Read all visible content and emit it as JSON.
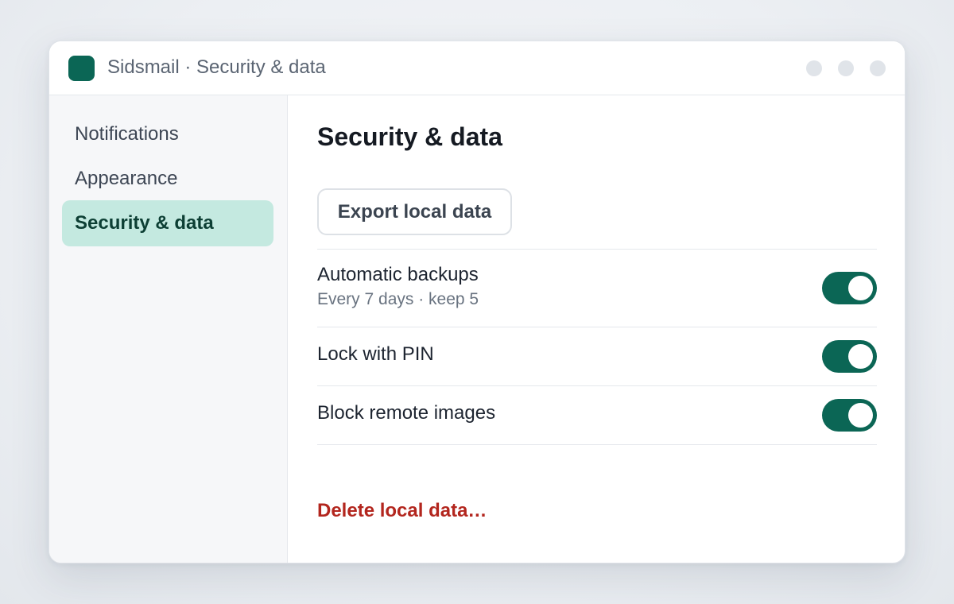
{
  "colors": {
    "accent": "#0b6655",
    "danger": "#b3261e",
    "active_nav_bg": "#c4e9e0"
  },
  "titlebar": {
    "app_icon": "app-logo-icon",
    "title": "Sidsmail · Security & data"
  },
  "sidebar": {
    "items": [
      {
        "label": "Notifications",
        "active": false
      },
      {
        "label": "Appearance",
        "active": false
      },
      {
        "label": "Security & data",
        "active": true
      }
    ]
  },
  "main": {
    "title": "Security & data",
    "export_button": "Export local data",
    "settings": [
      {
        "label": "Automatic backups",
        "sublabel": "Every 7 days · keep 5",
        "enabled": true
      },
      {
        "label": "Lock with PIN",
        "enabled": true
      },
      {
        "label": "Block remote images",
        "enabled": true
      }
    ],
    "delete_link": "Delete local data…"
  }
}
